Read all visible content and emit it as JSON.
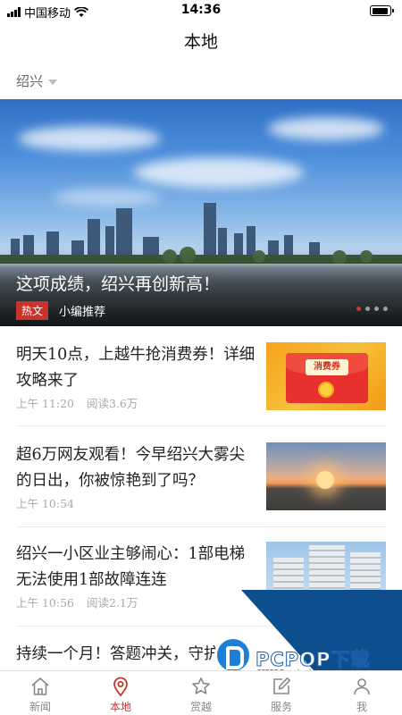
{
  "status_bar": {
    "carrier": "中国移动",
    "time": "14:36"
  },
  "header": {
    "title": "本地"
  },
  "city_selector": {
    "value": "绍兴"
  },
  "banner": {
    "title": "这项成绩，绍兴再创新高！",
    "tag": "热文",
    "source": "小编推荐",
    "slide_count": 4,
    "active_slide": 1
  },
  "articles": [
    {
      "title": "明天10点，上越牛抢消费券！详细攻略来了",
      "time": "上午 11:20",
      "reads": "阅读3.6万",
      "thumb_label": "消费券"
    },
    {
      "title": "超6万网友观看！今早绍兴大雾尖的日出，你被惊艳到了吗？",
      "time": "上午 10:54",
      "reads": ""
    },
    {
      "title": "绍兴一小区业主够闹心：1部电梯无法使用1部故障连连",
      "time": "上午 10:56",
      "reads": "阅读2.1万"
    },
    {
      "title": "持续一个月！答题冲关，守护"
    }
  ],
  "watermark": {
    "text": "PCPOP下载",
    "sub": "PCPOP Download"
  },
  "tabbar": {
    "items": [
      {
        "label": "新闻",
        "icon": "home-icon"
      },
      {
        "label": "本地",
        "icon": "location-pin-icon"
      },
      {
        "label": "赏越",
        "icon": "star-icon"
      },
      {
        "label": "服务",
        "icon": "edit-icon"
      },
      {
        "label": "我",
        "icon": "user-icon"
      }
    ],
    "active": "本地"
  },
  "colors": {
    "accent": "#c8332b",
    "text": "#222222",
    "meta": "#aaaaaa"
  }
}
